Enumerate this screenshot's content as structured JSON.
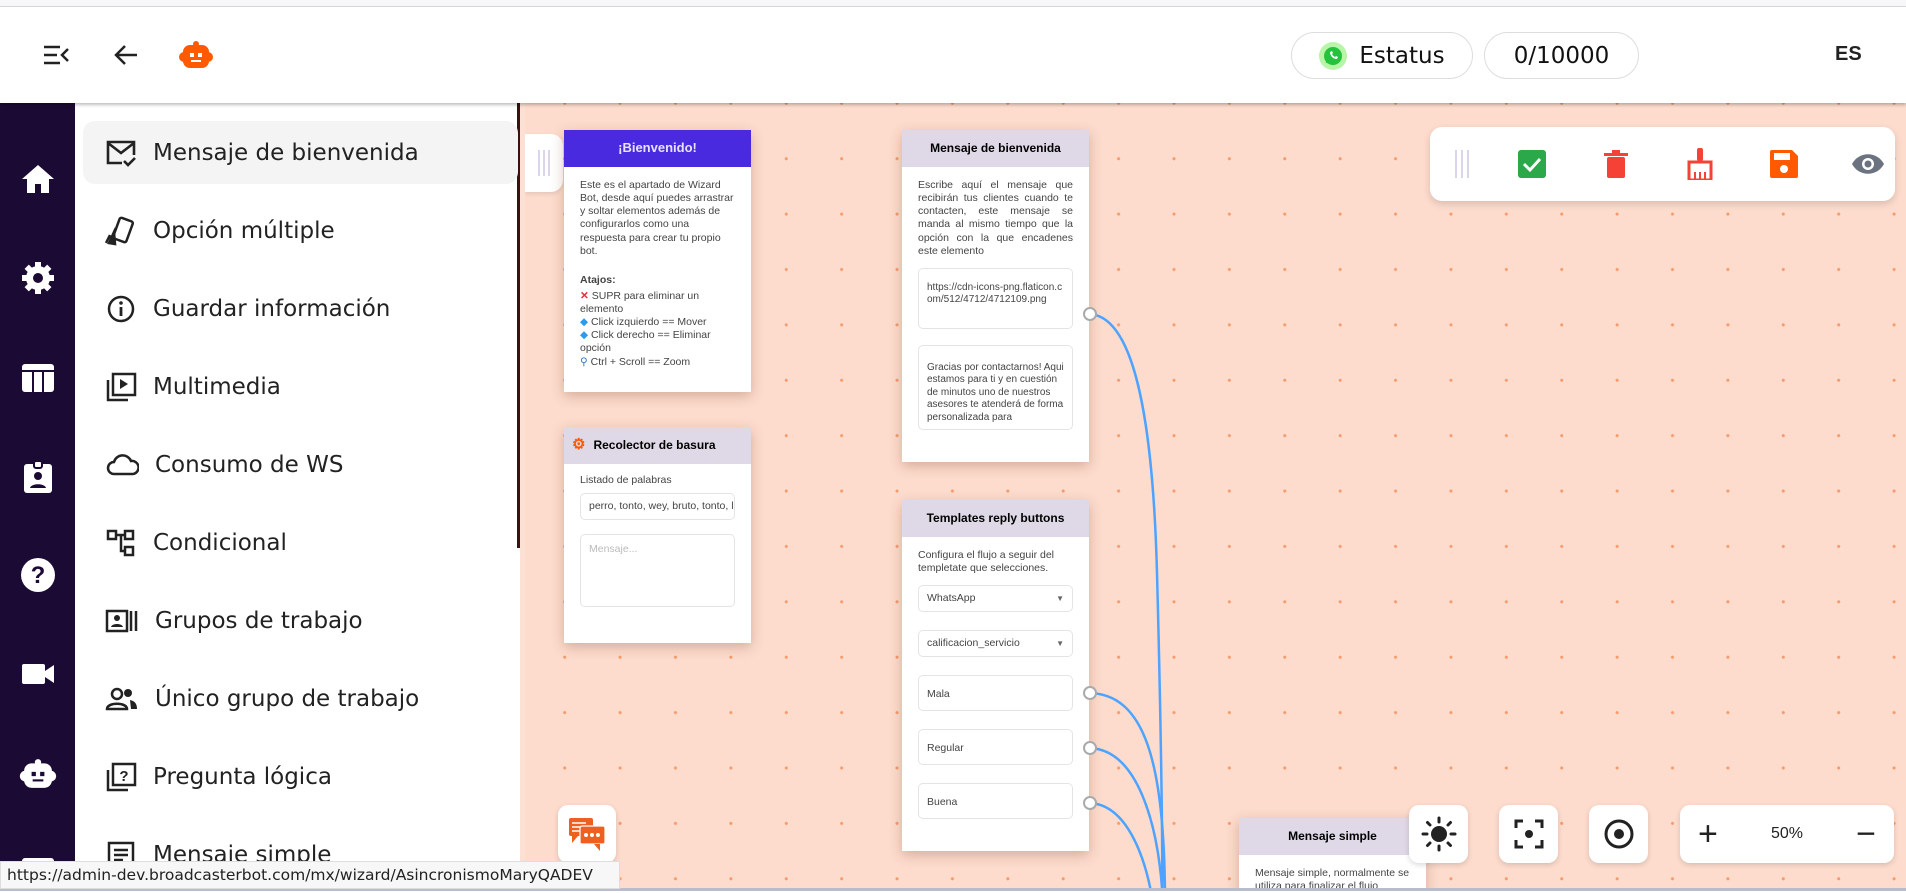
{
  "header": {
    "status_label": "Estatus",
    "counter": "0/10000",
    "language": "ES"
  },
  "sidebar": {
    "items": [
      {
        "label": "Mensaje de bienvenida",
        "icon": "mail-check-icon"
      },
      {
        "label": "Opción múltiple",
        "icon": "cards-icon"
      },
      {
        "label": "Guardar información",
        "icon": "info-icon"
      },
      {
        "label": "Multimedia",
        "icon": "video-library-icon"
      },
      {
        "label": "Consumo de WS",
        "icon": "cloud-icon"
      },
      {
        "label": "Condicional",
        "icon": "flow-icon"
      },
      {
        "label": "Grupos de trabajo",
        "icon": "contacts-icon"
      },
      {
        "label": "Único grupo de trabajo",
        "icon": "people-icon"
      },
      {
        "label": "Pregunta lógica",
        "icon": "quiz-icon"
      },
      {
        "label": "Mensaje simple",
        "icon": "article-icon"
      }
    ]
  },
  "rail": {
    "items": [
      "home-icon",
      "settings-icon",
      "table-icon",
      "badge-icon",
      "help-icon",
      "video-icon",
      "robot-icon"
    ]
  },
  "cards": {
    "welcome": {
      "title": "¡Bienvenido!",
      "body": "Este es el apartado de Wizard Bot, desde aquí puedes arrastrar y soltar elementos además de configurarlos como una respuesta para crear tu propio bot.",
      "shortcuts_title": "Atajos:",
      "shortcuts": [
        "SUPR para eliminar un elemento",
        "Click izquierdo == Mover",
        "Click derecho == Eliminar opción",
        "Ctrl + Scroll == Zoom"
      ]
    },
    "garbage": {
      "title": "Recolector de basura",
      "label": "Listado de palabras",
      "words": "perro, tonto, wey, bruto, tonto, l",
      "message_placeholder": "Mensaje..."
    },
    "welcome_msg": {
      "title": "Mensaje de bienvenida",
      "body": "Escribe aquí el mensaje que recibirán tus clientes cuando te contacten, este mensaje se manda al mismo tiempo que la opción con la que encadenes este elemento",
      "url": "https://cdn-icons-png.flaticon.com/512/4712/4712109.png",
      "message": "Gracias por contactarnos! Aqui estamos para ti y en cuestión de minutos uno de nuestros asesores te atenderá de forma personalizada para"
    },
    "templates": {
      "title": "Templates reply buttons",
      "body": "Configura el flujo a seguir del templetate que selecciones.",
      "channel": "WhatsApp",
      "template": "calificacion_servicio",
      "buttons": [
        "Mala",
        "Regular",
        "Buena"
      ]
    },
    "simple": {
      "title": "Mensaje simple",
      "body": "Mensaje simple, normalmente se utiliza para finalizar el flujo"
    }
  },
  "zoom": {
    "level": "50%"
  },
  "colors": {
    "accent": "#ff5a00",
    "rail": "#1b0a33",
    "welcome_header": "#4a2adf",
    "connector": "#4da3ff"
  },
  "status_url": "https://admin-dev.broadcasterbot.com/mx/wizard/AsincronismoMaryQADEV"
}
